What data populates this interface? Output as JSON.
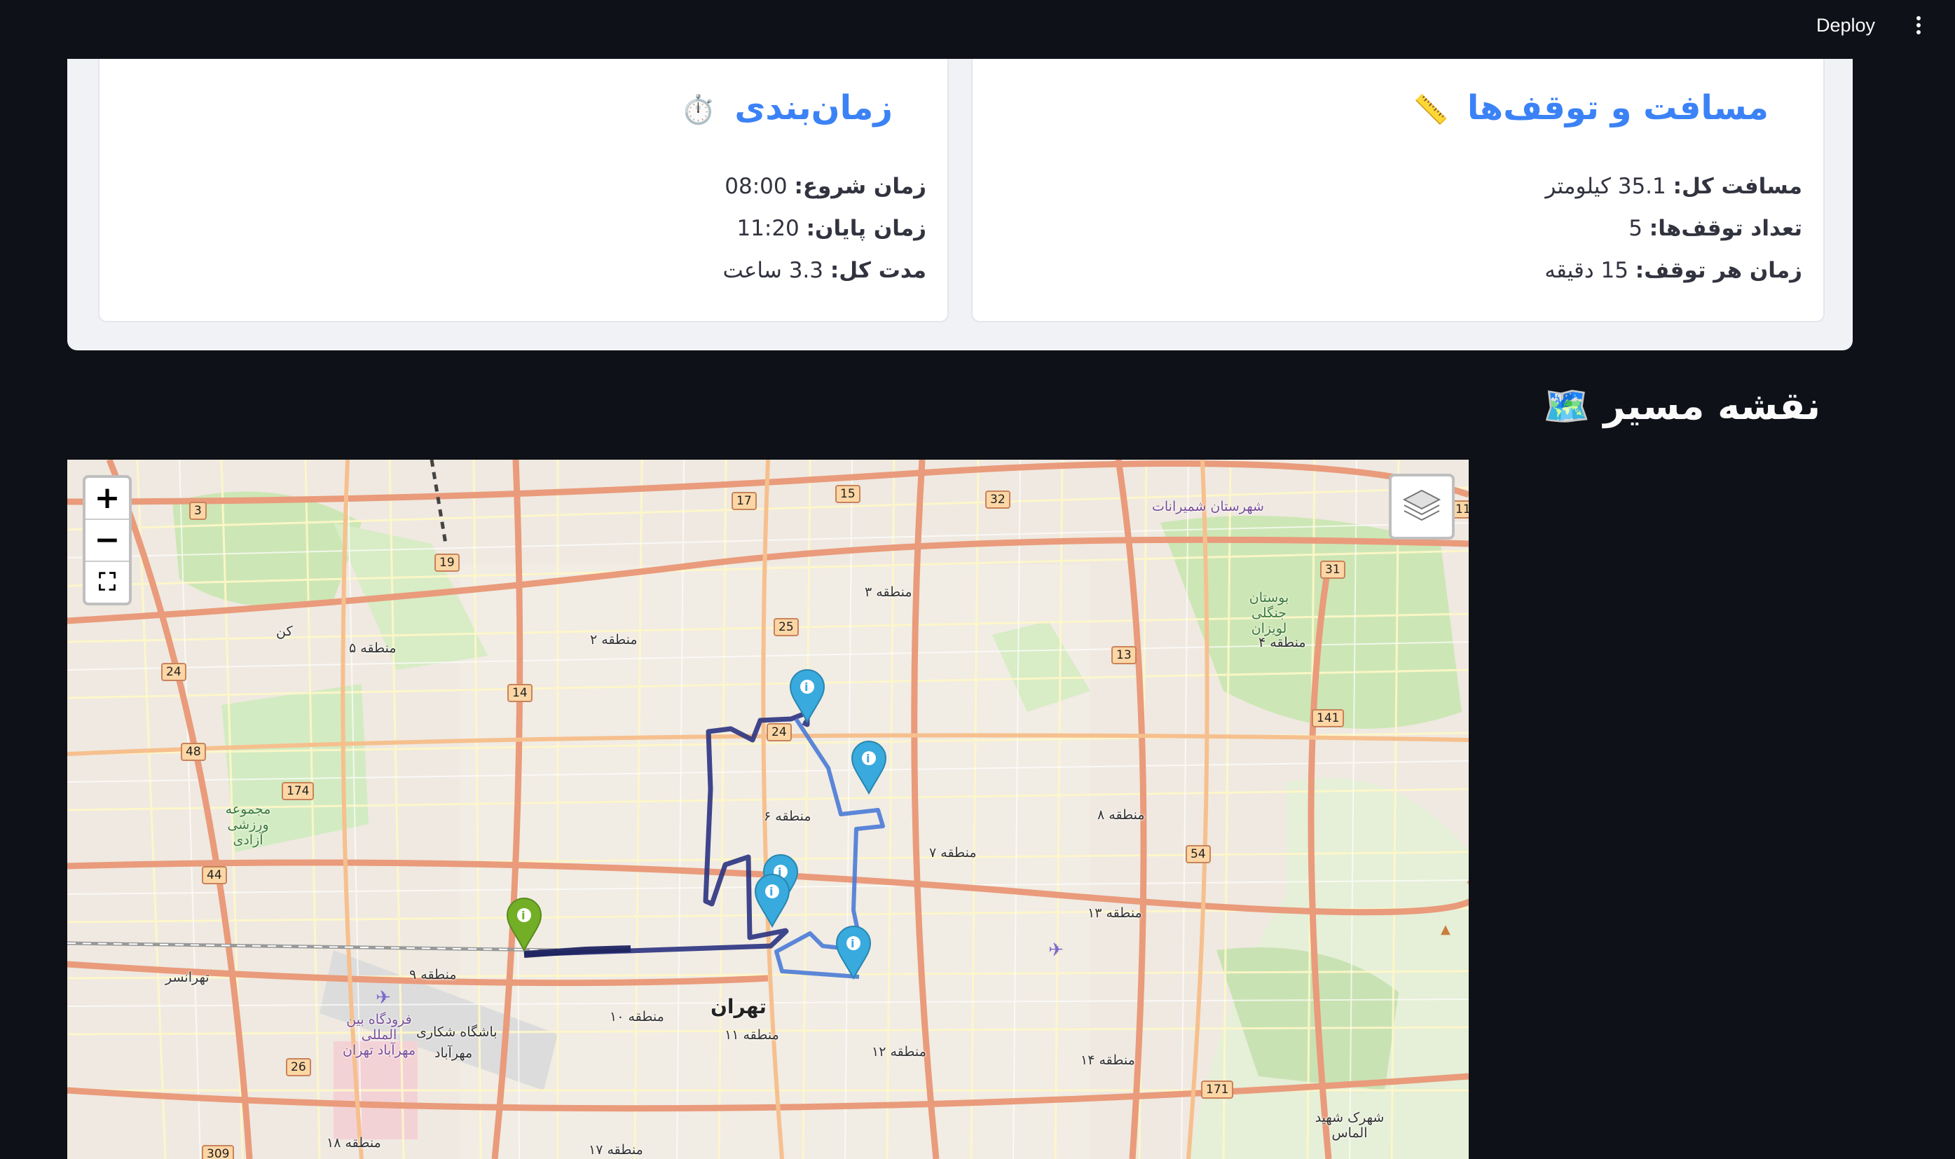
{
  "header": {
    "deploy_label": "Deploy",
    "menu_icon": "more-vertical-icon"
  },
  "timing_card": {
    "title": "زمان‌بندی",
    "emoji": "⏱️",
    "rows": [
      {
        "label": "زمان شروع:",
        "value": "08:00"
      },
      {
        "label": "زمان پایان:",
        "value": "11:20"
      },
      {
        "label": "مدت کل:",
        "value": "3.3 ساعت"
      }
    ]
  },
  "distance_card": {
    "title": "مسافت و توقف‌ها",
    "emoji": "📏",
    "rows": [
      {
        "label": "مسافت کل:",
        "value": "35.1 کیلومتر"
      },
      {
        "label": "تعداد توقف‌ها:",
        "value": "5"
      },
      {
        "label": "زمان هر توقف:",
        "value": "15 دقیقه"
      }
    ]
  },
  "map_section": {
    "title": "نقشه مسیر",
    "emoji": "🗺️",
    "zoom_in": "+",
    "zoom_out": "−",
    "fullscreen": "⛶",
    "labels": {
      "tehran": "تهران",
      "d1": "منطقه ۱۰",
      "d2": "منطقه ۲",
      "d3": "منطقه ۳",
      "d4": "منطقه ۴",
      "d5": "منطقه ۵",
      "d6": "منطقه ۶",
      "d7": "منطقه ۷",
      "d8": "منطقه ۸",
      "d9": "منطقه ۹",
      "d11": "منطقه ۱۱",
      "d12": "منطقه ۱۲",
      "d13": "منطقه ۱۳",
      "d14": "منطقه ۱۴",
      "d17": "منطقه ۱۷",
      "d18": "منطقه ۱۸",
      "airport": "فرودگاه بین المللی مهرآباد تهران",
      "mehrabad": "مهرآباد",
      "shooting": "باشگاه شکاری",
      "tehransar": "تهرانسر",
      "azadi": "مجموعه ورزشی آزادی",
      "lavizan": "بوستان جنگلی لویزان",
      "almas": "شهرک شهید الماس",
      "shemiranat": "شهرستان شمیرانات",
      "kan": "کن"
    },
    "road_numbers": [
      "3",
      "17",
      "15",
      "32",
      "19",
      "25",
      "31",
      "13",
      "14",
      "24",
      "48",
      "24",
      "141",
      "174",
      "44",
      "54",
      "26",
      "171",
      "309",
      "11"
    ]
  }
}
